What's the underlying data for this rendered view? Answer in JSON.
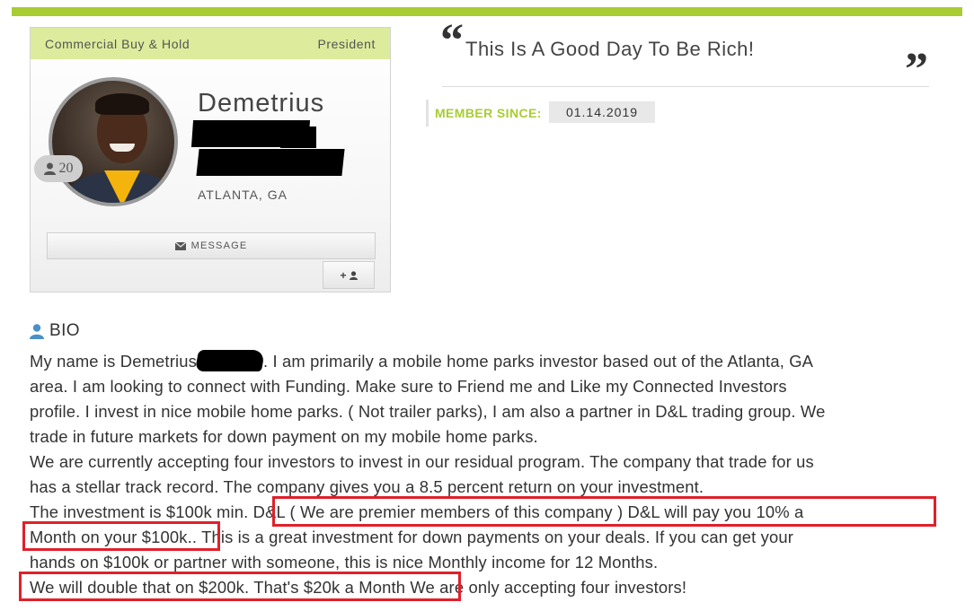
{
  "profile": {
    "category": "Commercial Buy & Hold",
    "role": "President",
    "name": "Demetrius",
    "location": "ATLANTA, GA",
    "friend_count": "20",
    "message_label": "MESSAGE",
    "add_friend_label": "+"
  },
  "quote": {
    "open_mark": "“",
    "text": "This Is A Good Day To Be Rich!",
    "close_mark": "”"
  },
  "member_since": {
    "label": "MEMBER SINCE:",
    "date": "01.14.2019"
  },
  "bio": {
    "title": "BIO",
    "line1_a": "My name is Demetrius",
    "line1_b": ". I am primarily a mobile home parks investor based out of the Atlanta, GA",
    "line2": "area. I am looking to connect with Funding. Make sure to Friend me and Like my Connected Investors",
    "line3": "profile. I invest in nice mobile home parks. ( Not trailer parks), I am also a partner in D&L trading group. We",
    "line4": "trade in future markets for down payment on my mobile home parks.",
    "line5": "We are currently accepting four investors to invest in our residual program. The company that trade for us",
    "line6": "has a stellar track record. The company gives you a 8.5 percent return on your investment.",
    "line7": "The investment is $100k min. D&L ( We are premier members of this company ) D&L will pay you 10% a",
    "line8": "Month on your $100k.. This is a great investment for down payments on your deals. If you can get your",
    "line9": "hands on $100k or partner with someone, this is nice Monthly income for 12 Months.",
    "line10": "We will double that on $200k. That's $20k a Month We are only accepting four investors!"
  },
  "colors": {
    "accent_green": "#a9cc33",
    "header_green": "#dcec9c",
    "highlight_red": "#e0202a"
  }
}
